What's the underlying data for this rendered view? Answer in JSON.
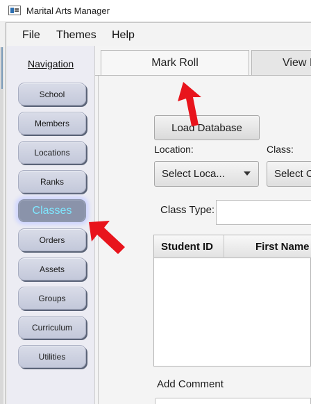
{
  "window": {
    "title": "Marital Arts Manager"
  },
  "menu": [
    "File",
    "Themes",
    "Help"
  ],
  "navigation": {
    "heading": "Navigation",
    "items": [
      {
        "label": "School"
      },
      {
        "label": "Members"
      },
      {
        "label": "Locations"
      },
      {
        "label": "Ranks"
      },
      {
        "label": "Classes",
        "active": true
      },
      {
        "label": "Orders"
      },
      {
        "label": "Assets"
      },
      {
        "label": "Groups"
      },
      {
        "label": "Curriculum"
      },
      {
        "label": "Utilities"
      }
    ]
  },
  "tabs": [
    {
      "label": "Mark Roll",
      "selected": true
    },
    {
      "label": "View I"
    }
  ],
  "form": {
    "load_button": "Load Database",
    "location_label": "Location:",
    "location_value": "Select Loca...",
    "class_label": "Class:",
    "class_value": "Select C",
    "class_type_label": "Class Type:",
    "class_type_value": ""
  },
  "table": {
    "columns": [
      "Student ID",
      "First Name"
    ]
  },
  "comment": {
    "label": "Add Comment"
  },
  "colors": {
    "arrow": "#e8141c",
    "nav_active": "#8a93aa",
    "nav_active_text": "#7fe7ff",
    "nav_button": "#c9cddd"
  }
}
